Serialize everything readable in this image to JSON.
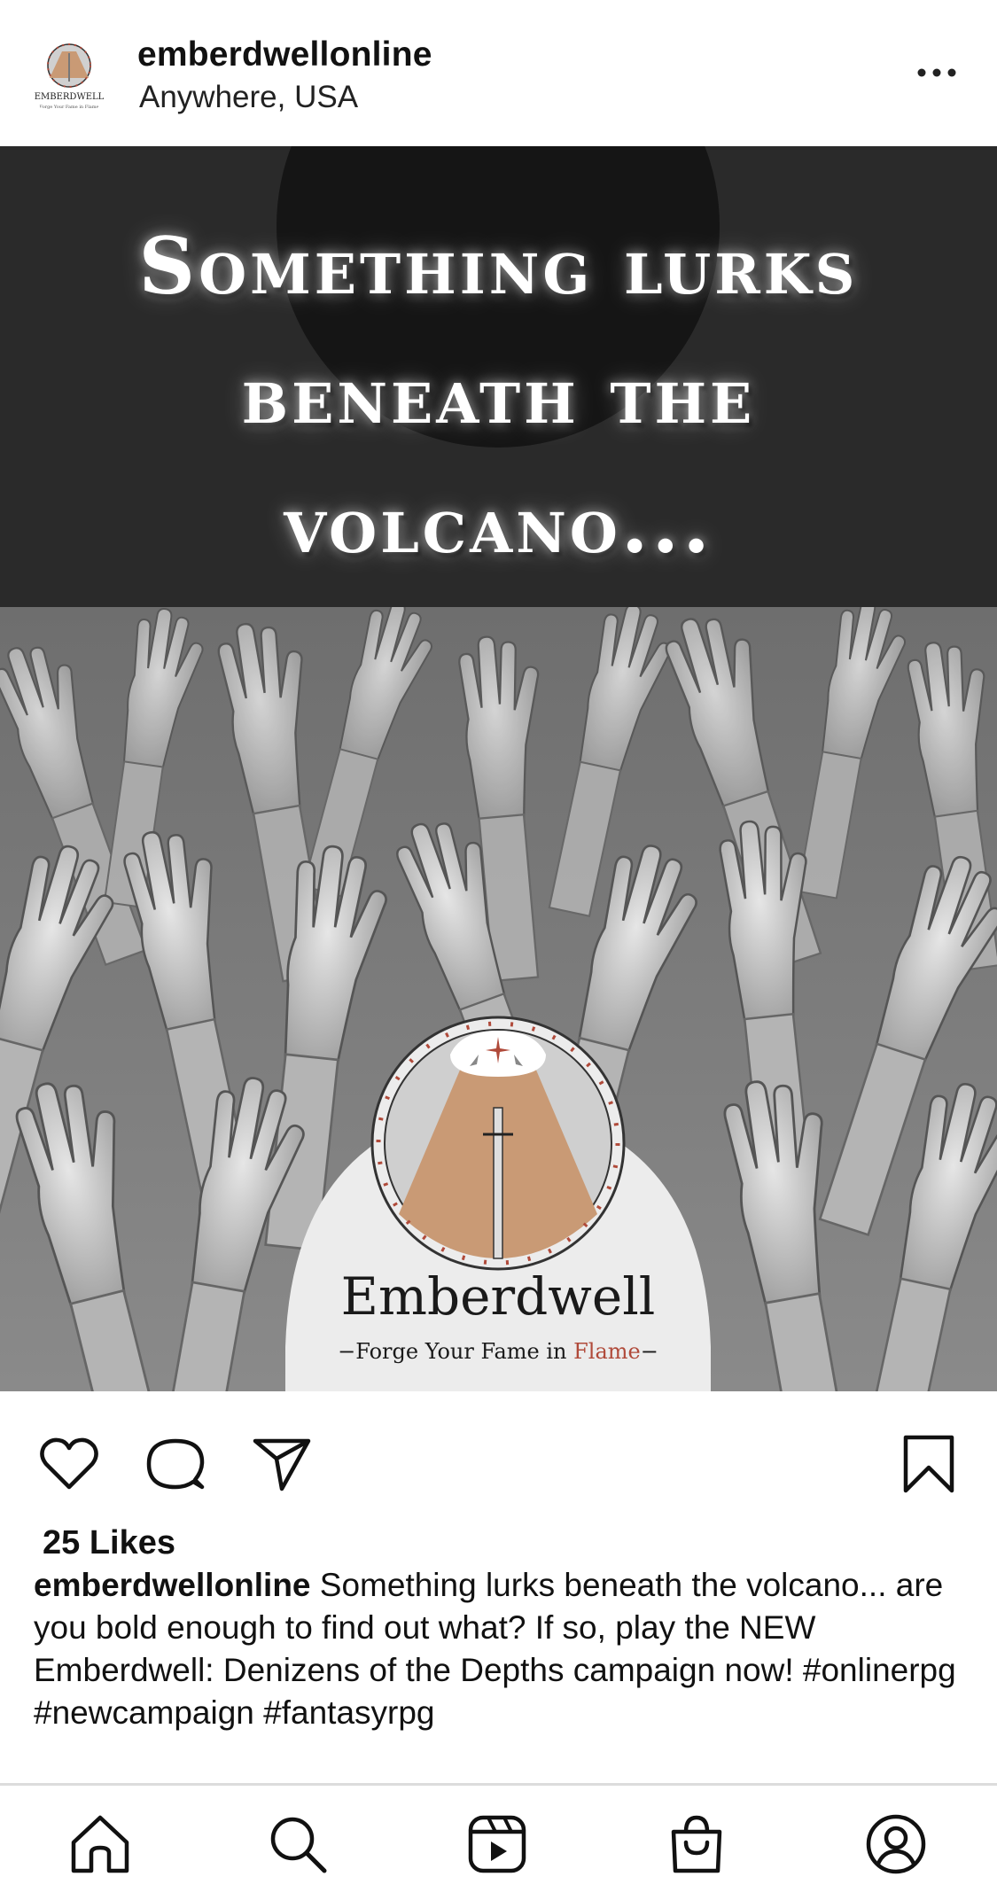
{
  "header": {
    "username": "emberdwellonline",
    "location": "Anywhere, USA"
  },
  "post": {
    "headline_lines": [
      "Something lurks",
      "beneath the",
      "volcano..."
    ],
    "logo": {
      "brand": "Emberdwell",
      "tagline_prefix": "−Forge Your Fame in ",
      "tagline_flame": "Flame",
      "tagline_suffix": "−"
    }
  },
  "actions": {
    "icons": [
      "heart-icon",
      "comment-icon",
      "share-icon",
      "bookmark-icon"
    ]
  },
  "likes": "25 Likes",
  "caption": {
    "username": "emberdwellonline",
    "text": " Something lurks beneath the volcano... are you bold enough to find out what? If so, play the NEW Emberdwell: Denizens of the Depths campaign now! #onlinerpg #newcampaign #fantasyrpg"
  },
  "bottom_nav": [
    "home-icon",
    "search-icon",
    "reels-icon",
    "shop-icon",
    "profile-icon"
  ],
  "colors": {
    "volcano": "#c99a75",
    "flame_text": "#b04a3a",
    "banner_bg": "#2a2a2a"
  }
}
